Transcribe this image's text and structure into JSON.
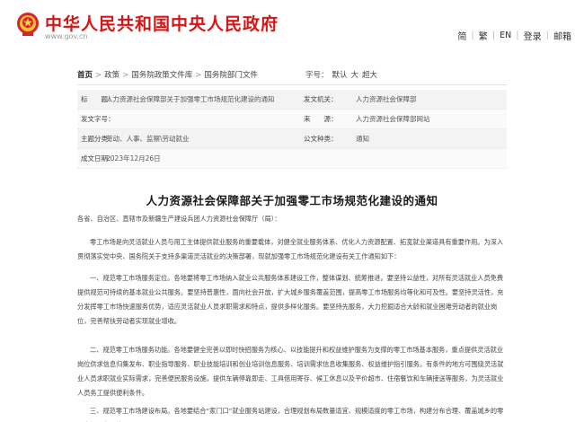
{
  "header": {
    "site_title": "中华人民共和国中央人民政府",
    "site_url": "www.gov.cn",
    "nav": [
      "简",
      "繁",
      "EN",
      "登录",
      "邮箱"
    ]
  },
  "breadcrumb": {
    "items": [
      "首页",
      "政策",
      "国务院政策文件库",
      "国务院部门文件"
    ],
    "size_label": "字号：",
    "sizes": [
      "默认",
      "大",
      "超大"
    ]
  },
  "meta": {
    "rows": [
      {
        "k1": "标　　题：",
        "v1": "人力资源社会保障部关于加强零工市场规范化建设的通知",
        "k2": "发文机关：",
        "v2": "人力资源社会保障部"
      },
      {
        "k1": "发文字号：",
        "v1": "",
        "k2": "来　　源：",
        "v2": "人力资源社会保障部网站"
      },
      {
        "k1": "主题分类：",
        "v1": "劳动、人事、监察\\劳动就业",
        "k2": "公文种类：",
        "v2": "通知"
      },
      {
        "k1": "成文日期：",
        "v1": "2023年12月26日",
        "k2": "",
        "v2": ""
      }
    ]
  },
  "article": {
    "title": "人力资源社会保障部关于加强零工市场规范化建设的通知",
    "salutation": "各省、自治区、直辖市及新疆生产建设兵团人力资源社会保障厅（局）：",
    "p1": "零工市场是向灵活就业人员与用工主体提供就业服务的重要载体，对健全就业服务体系、优化人力资源配置、拓宽就业渠道具有重要作用。为深入贯彻落实党中央、国务院关于支持多渠道灵活就业的决策部署，现就加强零工市场规范化建设有关工作通知如下：",
    "p2": "一、规范零工市场服务定位。各地要将零工市场纳入就业公共服务体系建设工作，整体谋划、统筹推进。要坚持公益性，对所有灵活就业人员免费提供规范可持续的基本就业公共服务。要坚持普惠性，面向社会开放，扩大城乡服务覆盖范围，提高零工市场服务均等化和可及性。要坚持灵活性，充分发挥零工市场快速服务优势，适应灵活就业人员求职需求和特点，提供多样化服务。要坚持先服务，大力挖掘适合大龄和就业困难劳动者的就业岗位，完善帮扶劳动者实现就业增收。",
    "p3": "二、规范零工市场服务功能。各地要健全完善以即时快招服务为核心、以技能提升和权益维护服务为支撑的零工市场基本服务，重点提供灵活就业岗位供求信息归集发布、职业指导服务、职业技能培训和创业培训信息服务、培训需求信息收集服务、权益维护指引服务。有条件的地方可围绕灵活就业人员求职就业实际需求，完善便民服务设施，提供车辆停靠即走、工具借用寄存、候工休息以及平价超市、住宿餐饮和车辆接送等服务，为灵活就业人员务工提供便利条件。",
    "p4": "三、规范零工市场建设布局。各地要结合“家门口”就业服务站建设，合理规划布局数量适宜、规模适度的零工市场，构建分布合理、覆盖城乡的零工市场服务网络。"
  },
  "colors": {
    "brand_red": "#d51616"
  }
}
